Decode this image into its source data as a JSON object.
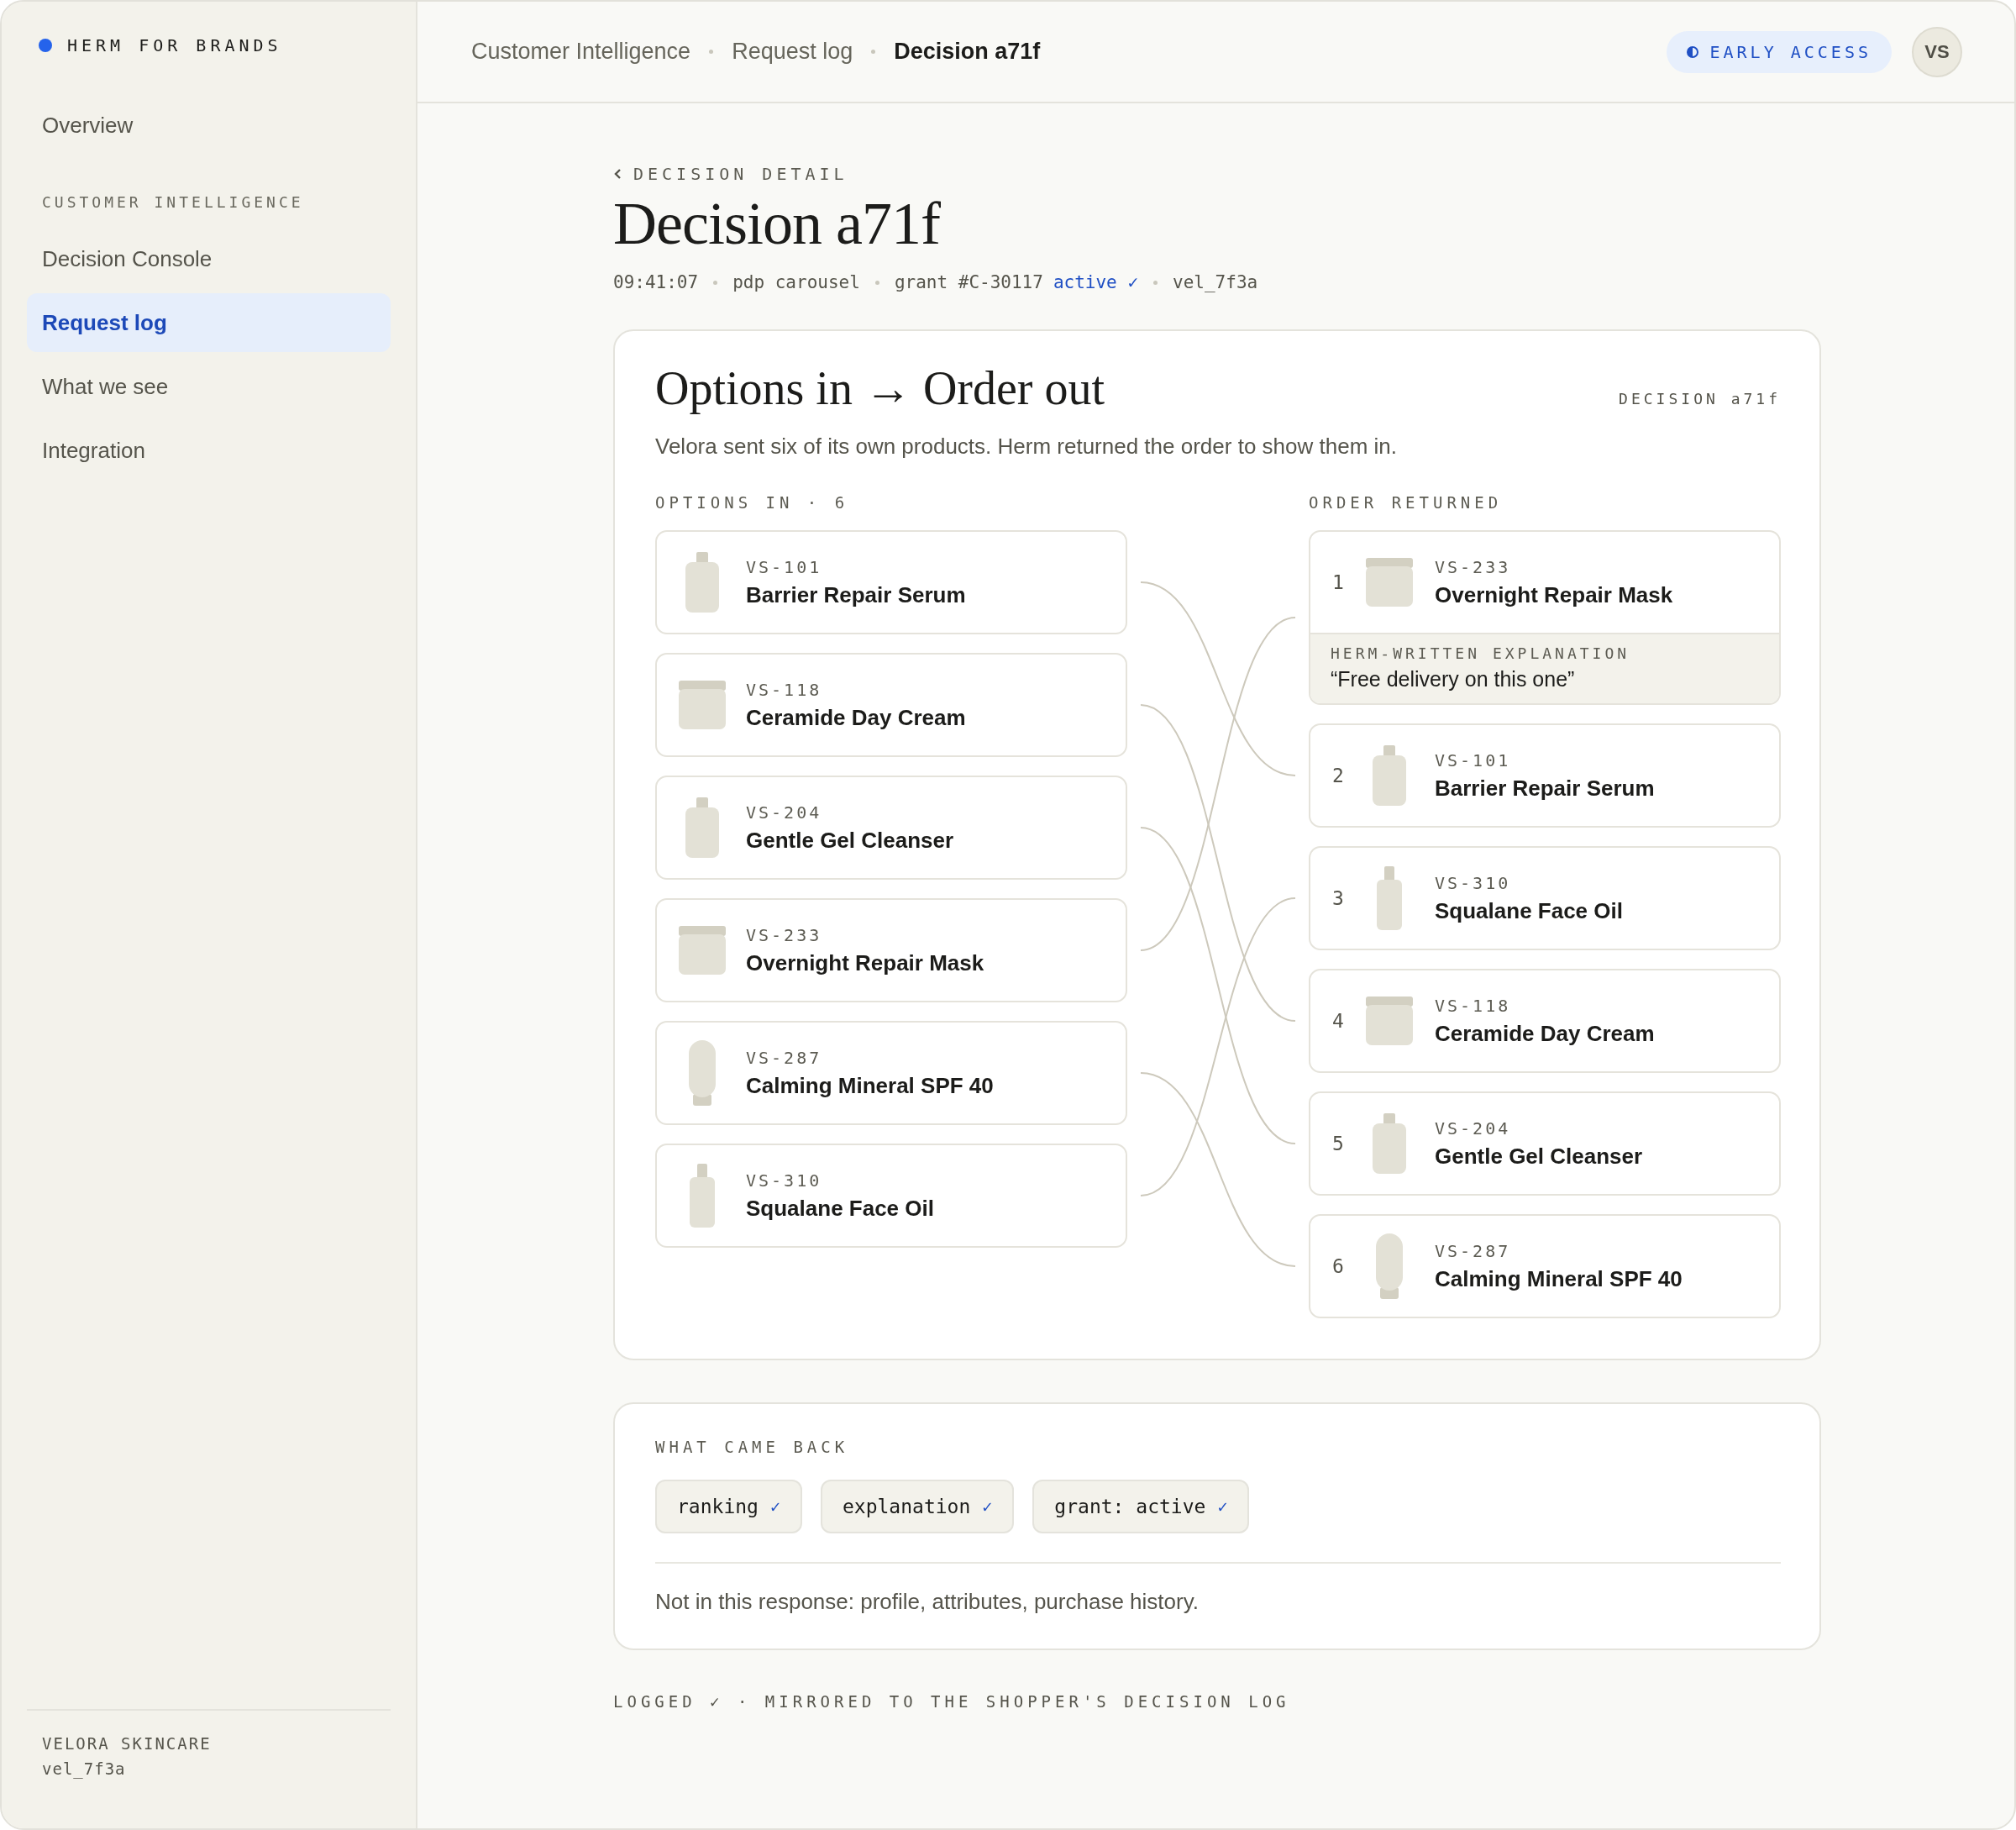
{
  "sidebar": {
    "brand": "HERM FOR BRANDS",
    "items": [
      {
        "kind": "link",
        "label": "Overview",
        "selected": false
      },
      {
        "kind": "section",
        "label": "CUSTOMER INTELLIGENCE"
      },
      {
        "kind": "link",
        "label": "Decision Console",
        "selected": false
      },
      {
        "kind": "link",
        "label": "Request log",
        "selected": true
      },
      {
        "kind": "link",
        "label": "What we see",
        "selected": false
      },
      {
        "kind": "link",
        "label": "Integration",
        "selected": false
      }
    ],
    "account": {
      "name": "VELORA SKINCARE",
      "id": "vel_7f3a"
    }
  },
  "header": {
    "breadcrumbs": [
      {
        "label": "Customer Intelligence",
        "selected": false
      },
      {
        "label": "Request log",
        "selected": false
      },
      {
        "label": "Decision a71f",
        "selected": true
      }
    ],
    "badge": "EARLY ACCESS",
    "avatar": "VS"
  },
  "page": {
    "back": "DECISION DETAIL",
    "title": "Decision a71f",
    "meta": [
      {
        "text": "09:41:07"
      },
      {
        "text": "pdp carousel"
      },
      {
        "text": "grant #C-30117",
        "status": "active ✓"
      },
      {
        "text": "vel_7f3a"
      }
    ]
  },
  "options_card": {
    "title": "Options in → Order out",
    "tag": "DECISION a71f",
    "description": "Velora sent six of its own products. Herm returned the order to show them in.",
    "in_label": "OPTIONS IN · 6",
    "out_label": "ORDER RETURNED",
    "options_in": [
      {
        "code": "VS-101",
        "name": "Barrier Repair Serum",
        "kind": "bottle"
      },
      {
        "code": "VS-118",
        "name": "Ceramide Day Cream",
        "kind": "jar"
      },
      {
        "code": "VS-204",
        "name": "Gentle Gel Cleanser",
        "kind": "bottle"
      },
      {
        "code": "VS-233",
        "name": "Overnight Repair Mask",
        "kind": "jar"
      },
      {
        "code": "VS-287",
        "name": "Calming Mineral SPF 40",
        "kind": "tube"
      },
      {
        "code": "VS-310",
        "name": "Squalane Face Oil",
        "kind": "dropper"
      }
    ],
    "order_out": [
      {
        "rank": "1",
        "code": "VS-233",
        "name": "Overnight Repair Mask",
        "kind": "jar",
        "explanation": {
          "label": "HERM-WRITTEN EXPLANATION",
          "text": "“Free delivery on this one”"
        }
      },
      {
        "rank": "2",
        "code": "VS-101",
        "name": "Barrier Repair Serum",
        "kind": "bottle"
      },
      {
        "rank": "3",
        "code": "VS-310",
        "name": "Squalane Face Oil",
        "kind": "dropper"
      },
      {
        "rank": "4",
        "code": "VS-118",
        "name": "Ceramide Day Cream",
        "kind": "jar"
      },
      {
        "rank": "5",
        "code": "VS-204",
        "name": "Gentle Gel Cleanser",
        "kind": "bottle"
      },
      {
        "rank": "6",
        "code": "VS-287",
        "name": "Calming Mineral SPF 40",
        "kind": "tube"
      }
    ]
  },
  "returned_card": {
    "label": "WHAT CAME BACK",
    "chips": [
      {
        "label": "ranking",
        "mark": "✓"
      },
      {
        "label": "explanation",
        "mark": "✓"
      },
      {
        "label": "grant: active",
        "mark": "✓"
      }
    ],
    "note": "Not in this response: profile, attributes, purchase history."
  },
  "footer": "LOGGED ✓ · MIRRORED TO THE SHOPPER'S DECISION LOG"
}
